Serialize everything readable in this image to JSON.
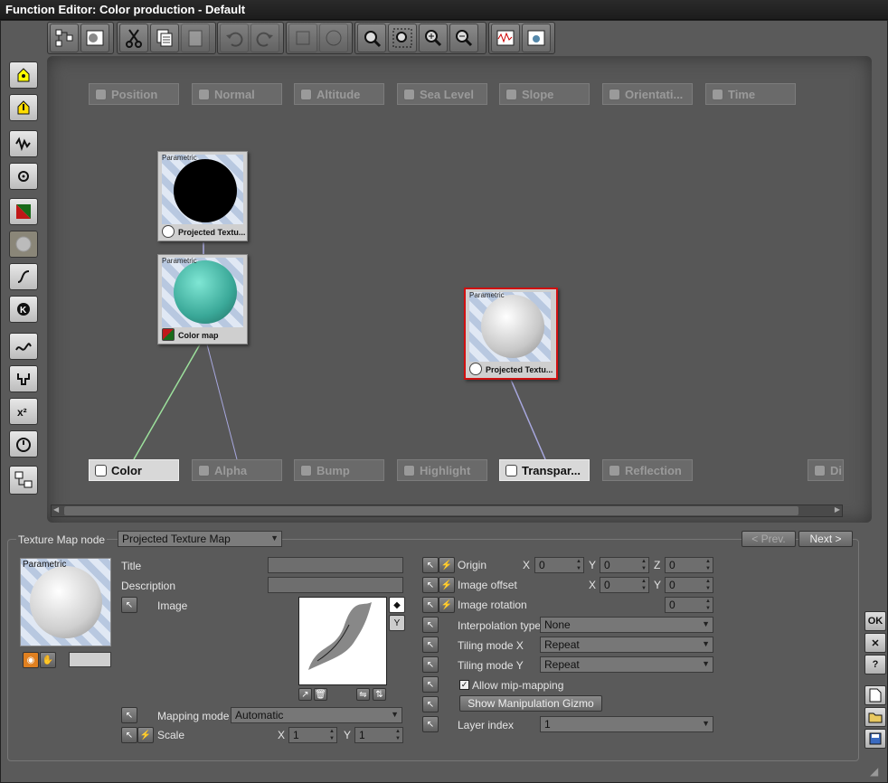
{
  "window": {
    "title": "Function Editor: Color production - Default"
  },
  "graph": {
    "inputs": [
      "Position",
      "Normal",
      "Altitude",
      "Sea Level",
      "Slope",
      "Orientati...",
      "Time"
    ],
    "outputs": [
      {
        "label": "Color",
        "active": true
      },
      {
        "label": "Alpha",
        "active": false
      },
      {
        "label": "Bump",
        "active": false
      },
      {
        "label": "Highlight",
        "active": false
      },
      {
        "label": "Transpar...",
        "active": true
      },
      {
        "label": "Reflection",
        "active": false
      },
      {
        "label": "Di",
        "active": false
      }
    ],
    "nodes": [
      {
        "type": "Parametric",
        "label": "Projected Textu...",
        "sphere": "black",
        "selected": false
      },
      {
        "type": "Parametric",
        "label": "Color map",
        "sphere": "teal",
        "selected": false
      },
      {
        "type": "Parametric",
        "label": "Projected Textu...",
        "sphere": "white",
        "selected": true
      }
    ]
  },
  "panel": {
    "node_kind_label": "Texture Map node",
    "node_kind_value": "Projected Texture Map",
    "prev_label": "< Prev.",
    "next_label": "Next >",
    "preview_type": "Parametric",
    "title_label": "Title",
    "title_value": "",
    "description_label": "Description",
    "description_value": "",
    "image_label": "Image",
    "mapping_label": "Mapping mode",
    "mapping_value": "Automatic",
    "scale_label": "Scale",
    "scale_x": "1",
    "scale_y": "1",
    "origin_label": "Origin",
    "origin_x": "0",
    "origin_y": "0",
    "origin_z": "0",
    "offset_label": "Image offset",
    "offset_x": "0",
    "offset_y": "0",
    "rotation_label": "Image rotation",
    "rotation_value": "0",
    "interp_label": "Interpolation type",
    "interp_value": "None",
    "tilex_label": "Tiling mode X",
    "tilex_value": "Repeat",
    "tiley_label": "Tiling mode Y",
    "tiley_value": "Repeat",
    "mip_label": "Allow mip-mapping",
    "mip_checked": true,
    "gizmo_label": "Show Manipulation Gizmo",
    "layer_label": "Layer index",
    "layer_value": "1",
    "axis_x": "X",
    "axis_y": "Y",
    "axis_z": "Z"
  },
  "right_buttons": {
    "ok": "OK",
    "cancel": "✕",
    "help": "?"
  }
}
